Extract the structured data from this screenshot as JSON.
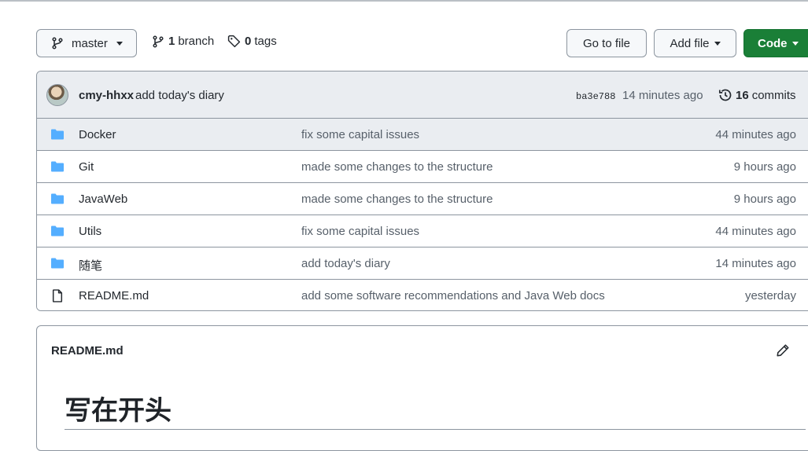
{
  "toolbar": {
    "branch_label": "master",
    "branches_count": "1",
    "branches_label": "branch",
    "tags_count": "0",
    "tags_label": "tags",
    "goto_file_label": "Go to file",
    "add_file_label": "Add file",
    "code_label": "Code",
    "code_button_color": "#1a7f37"
  },
  "latest_commit": {
    "author": "cmy-hhxx",
    "message": "add today's diary",
    "sha": "ba3e788",
    "time": "14 minutes ago",
    "commits_count": "16",
    "commits_label": "commits"
  },
  "files": [
    {
      "type": "folder",
      "icon": "folder-icon",
      "name": "Docker",
      "message": "fix some capital issues",
      "age": "44 minutes ago"
    },
    {
      "type": "folder",
      "icon": "folder-icon",
      "name": "Git",
      "message": "made some changes to the structure",
      "age": "9 hours ago"
    },
    {
      "type": "folder",
      "icon": "folder-icon",
      "name": "JavaWeb",
      "message": "made some changes to the structure",
      "age": "9 hours ago"
    },
    {
      "type": "folder",
      "icon": "folder-icon",
      "name": "Utils",
      "message": "fix some capital issues",
      "age": "44 minutes ago"
    },
    {
      "type": "folder",
      "icon": "folder-icon",
      "name": "随笔",
      "message": "add today's diary",
      "age": "14 minutes ago"
    },
    {
      "type": "file",
      "icon": "file-icon",
      "name": "README.md",
      "message": "add some software recommendations and Java Web docs",
      "age": "yesterday"
    }
  ],
  "readme": {
    "title": "README.md",
    "heading": "写在开头"
  },
  "colors": {
    "folder": "#54aeff",
    "border": "#8c959f",
    "header_bg": "#eaedf1"
  }
}
